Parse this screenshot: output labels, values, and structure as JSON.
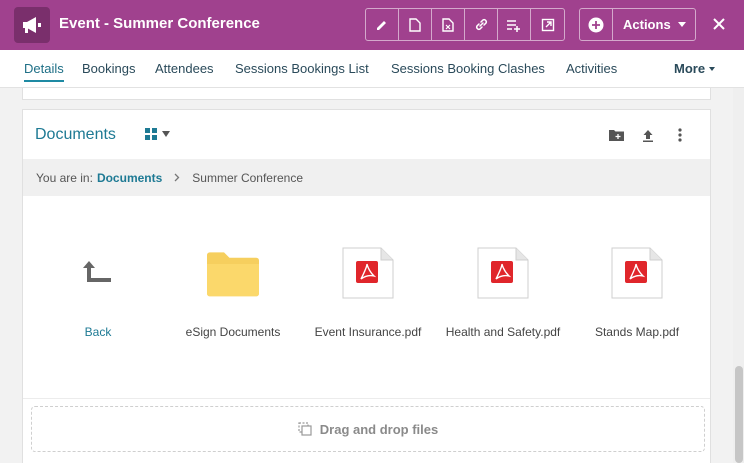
{
  "header": {
    "title": "Event - Summer Conference",
    "app_icon": "megaphone-icon",
    "tools": [
      "pencil-icon",
      "document-icon",
      "document-x-icon",
      "link-icon",
      "playlist-add-icon",
      "open-external-icon"
    ],
    "actions_label": "Actions",
    "accent_color": "#a0418e"
  },
  "tabs": {
    "items": [
      "Details",
      "Bookings",
      "Attendees",
      "Sessions Bookings List",
      "Sessions Booking Clashes",
      "Activities"
    ],
    "active": "Details",
    "more_label": "More"
  },
  "documents": {
    "title": "Documents",
    "breadcrumb": {
      "prefix": "You are in:",
      "root": "Documents",
      "current": "Summer Conference"
    },
    "items": [
      {
        "label": "Back",
        "icon": "back-arrow-icon"
      },
      {
        "label": "eSign Documents",
        "icon": "folder-icon"
      },
      {
        "label": "Event Insurance.pdf",
        "icon": "pdf-icon"
      },
      {
        "label": "Health and Safety.pdf",
        "icon": "pdf-icon"
      },
      {
        "label": "Stands Map.pdf",
        "icon": "pdf-icon"
      }
    ],
    "dropzone_label": "Drag and drop files"
  }
}
